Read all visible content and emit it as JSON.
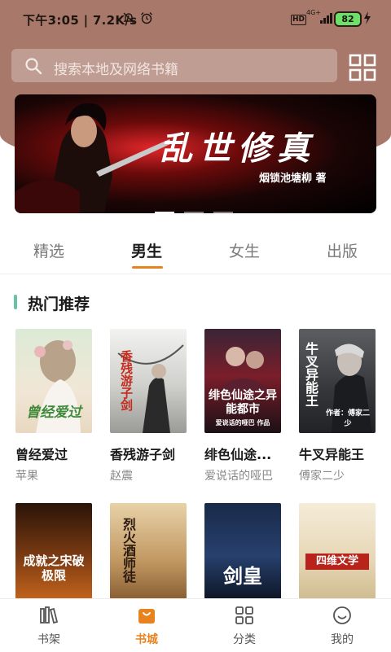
{
  "status_bar": {
    "time": "下午3:05 | 7.2K/s",
    "hd": "HD",
    "network": "4G+",
    "battery": "82"
  },
  "search": {
    "placeholder": "搜索本地及网络书籍"
  },
  "banner": {
    "title": "乱世修真",
    "author": "烟锁池塘柳 著",
    "slides": 3,
    "active_slide": 1
  },
  "tabs": [
    {
      "label": "精选",
      "active": false
    },
    {
      "label": "男生",
      "active": true
    },
    {
      "label": "女生",
      "active": false
    },
    {
      "label": "出版",
      "active": false
    }
  ],
  "section": {
    "title": "热门推荐",
    "accent": "#6ac1a3"
  },
  "books_row1": [
    {
      "title": "曾经爱过",
      "author": "苹果",
      "cover_text": "曾经爱过"
    },
    {
      "title": "香残游子剑",
      "author": "赵震",
      "cover_text": "香残游子剑"
    },
    {
      "title": "绯色仙途...",
      "author": "爱说话的哑巴",
      "cover_text": "绯色仙途之异能都市",
      "cover_sub": "爱说话的哑巴 作品"
    },
    {
      "title": "牛叉异能王",
      "author": "傅家二少",
      "cover_text": "牛叉异能王",
      "cover_sub": "作者：傅家二少"
    }
  ],
  "books_row2": [
    {
      "cover_text": "成就之宋破极限"
    },
    {
      "cover_text": "烈火酒师徒"
    },
    {
      "cover_text": "剑皇"
    },
    {
      "cover_text": "四维文学"
    }
  ],
  "tabbar": [
    {
      "label": "书架",
      "icon": "bookshelf-icon",
      "active": false
    },
    {
      "label": "书城",
      "icon": "bag-icon",
      "active": true
    },
    {
      "label": "分类",
      "icon": "category-grid-icon",
      "active": false
    },
    {
      "label": "我的",
      "icon": "smiley-icon",
      "active": false
    }
  ],
  "colors": {
    "accent": "#e8821e",
    "header_bg": "#a8786a"
  }
}
